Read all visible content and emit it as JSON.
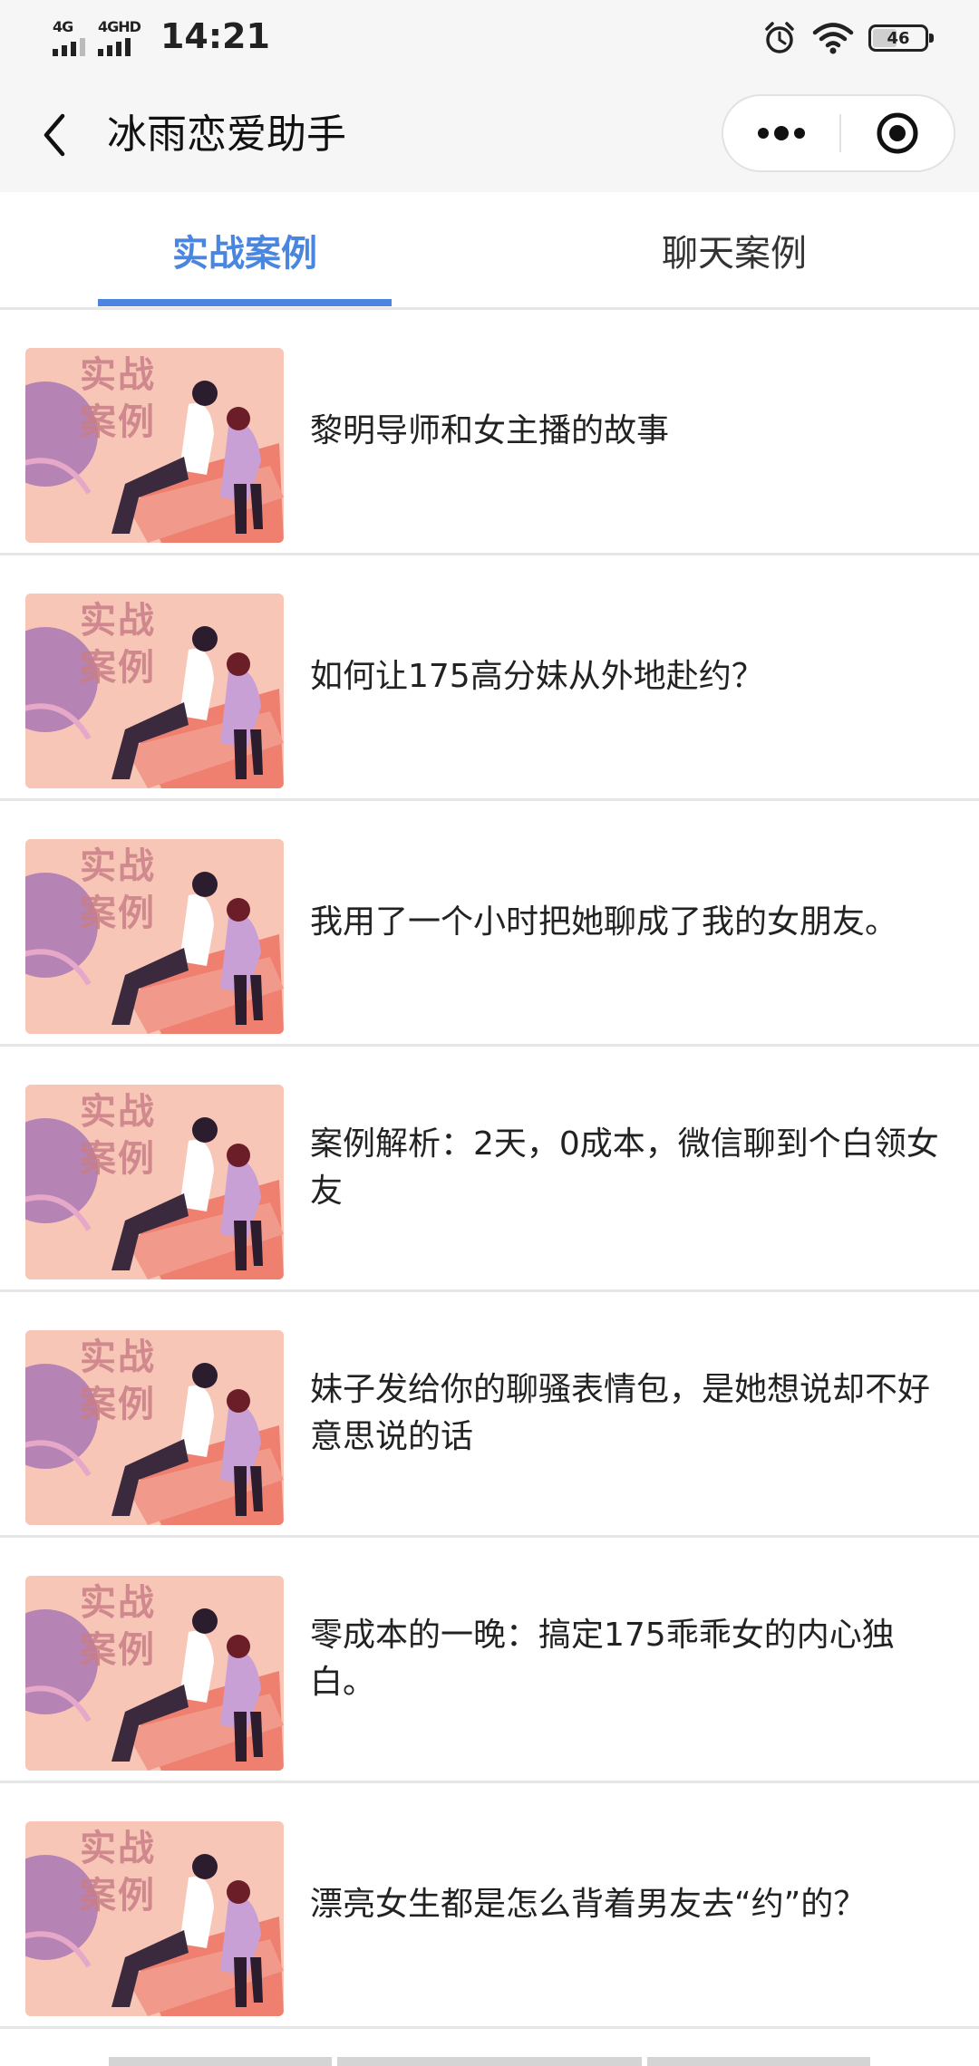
{
  "status_bar": {
    "signal_1": "4G",
    "signal_2": "4GHD",
    "time": "14:21",
    "battery": "46",
    "alarm_icon": "alarm-clock-icon",
    "wifi_icon": "wifi-icon"
  },
  "nav": {
    "title": "冰雨恋爱助手",
    "back_icon": "chevron-left-icon",
    "more_icon": "more-dots-icon",
    "close_icon": "target-circle-icon"
  },
  "tabs": [
    {
      "label": "实战案例",
      "active": true
    },
    {
      "label": "聊天案例",
      "active": false
    }
  ],
  "colors": {
    "accent": "#4a86e0",
    "thumb_bg": "#f7c3b4"
  },
  "thumb_label": "实战\n案例",
  "articles": [
    {
      "title": "黎明导师和女主播的故事"
    },
    {
      "title": "如何让175高分妹从外地赴约？"
    },
    {
      "title": "我用了一个小时把她聊成了我的女朋友。"
    },
    {
      "title": "案例解析：2天，0成本，微信聊到个白领女友"
    },
    {
      "title": "妹子发给你的聊骚表情包，是她想说却不好意思说的话"
    },
    {
      "title": "零成本的一晚：搞定175乖乖女的内心独白。"
    },
    {
      "title": "漂亮女生都是怎么背着男友去“约”的？"
    }
  ]
}
